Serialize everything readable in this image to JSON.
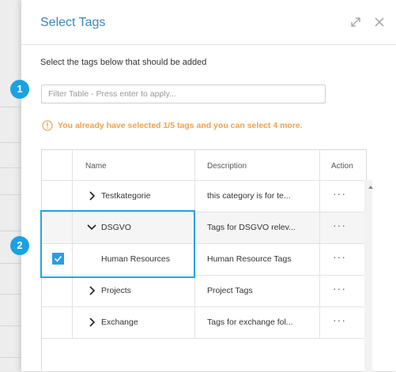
{
  "dialog": {
    "title": "Select Tags",
    "instruction": "Select the tags below that should be added",
    "filter_placeholder": "Filter Table - Press enter to apply...",
    "warning": "You already have selected 1/5 tags and you can select 4 more."
  },
  "table": {
    "columns": [
      "Name",
      "Description",
      "Action"
    ],
    "rows": [
      {
        "name": "Testkategorie",
        "description": "this category is for te...",
        "action": "···",
        "chevron": "chevron-right",
        "checked": false
      },
      {
        "name": "DSGVO",
        "description": "Tags for DSGVO relev...",
        "action": "···",
        "chevron": "chevron-down",
        "checked": false
      },
      {
        "name": "Human Resources",
        "description": "Human Resource Tags",
        "action": "···",
        "chevron": "",
        "checked": true
      },
      {
        "name": "Projects",
        "description": "Project Tags",
        "action": "···",
        "chevron": "chevron-right",
        "checked": false
      },
      {
        "name": "Exchange",
        "description": "Tags for exchange fol...",
        "action": "···",
        "chevron": "chevron-right",
        "checked": false
      }
    ]
  },
  "callouts": {
    "one": "1",
    "two": "2"
  },
  "colors": {
    "accent": "#2a9de0",
    "warning": "#f0a14a",
    "title": "#3a86b7"
  },
  "icons": [
    "expand-icon",
    "close-icon",
    "info-icon",
    "chevron-right-icon",
    "chevron-down-icon",
    "check-icon",
    "scroll-up-arrow-icon"
  ]
}
